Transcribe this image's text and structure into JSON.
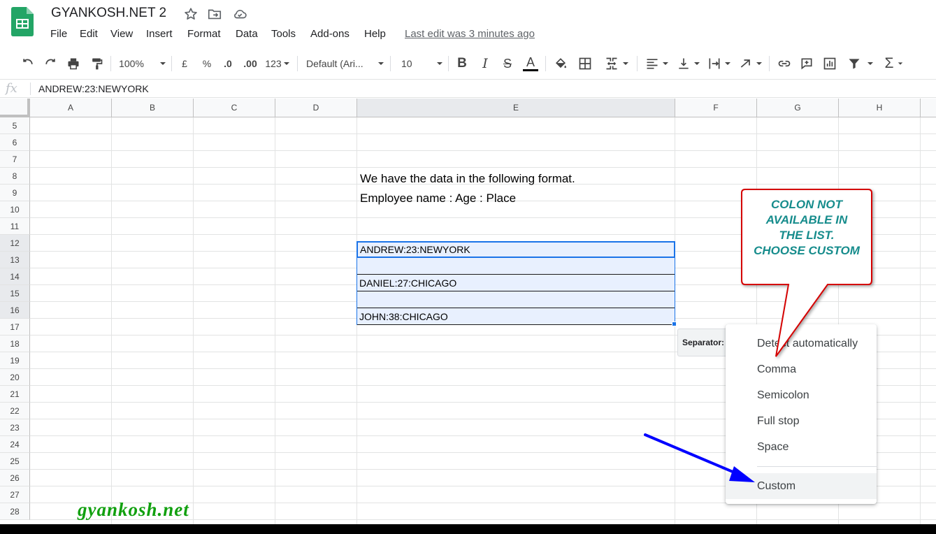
{
  "app": {
    "doc_title": "GYANKOSH.NET 2",
    "last_edit": "Last edit was 3 minutes ago",
    "brand_color": "#188038"
  },
  "menu": [
    "File",
    "Edit",
    "View",
    "Insert",
    "Format",
    "Data",
    "Tools",
    "Add-ons",
    "Help"
  ],
  "toolbar": {
    "zoom": "100%",
    "currency": "£",
    "percent": "%",
    "dec_decrease": ".0",
    "dec_increase": ".00",
    "more_formats": "123",
    "font": "Default (Ari...",
    "font_size": "10",
    "bold": "B",
    "italic": "I",
    "strike": "S",
    "text_color_letter": "A",
    "sigma": "Σ"
  },
  "formula_bar": {
    "fx": "fx",
    "value": "ANDREW:23:NEWYORK"
  },
  "grid": {
    "columns": [
      "A",
      "B",
      "C",
      "D",
      "E",
      "F",
      "G",
      "H"
    ],
    "selected_column": "E",
    "rows": [
      "5",
      "6",
      "7",
      "8",
      "9",
      "10",
      "11",
      "12",
      "13",
      "14",
      "15",
      "16",
      "17",
      "18",
      "19",
      "20",
      "21",
      "22",
      "23",
      "24",
      "25",
      "26",
      "27",
      "28"
    ],
    "selected_rows": [
      "12",
      "13",
      "14",
      "15",
      "16"
    ],
    "notes": {
      "row8": "We have the data in the following format.",
      "row9": "Employee name : Age : Place"
    },
    "data": {
      "e12": "ANDREW:23:NEWYORK",
      "e13": "",
      "e14": "DANIEL:27:CHICAGO",
      "e15": "",
      "e16": "JOHN:38:CHICAGO"
    }
  },
  "separator": {
    "label": "Separator:",
    "options": [
      "Detect automatically",
      "Comma",
      "Semicolon",
      "Full stop",
      "Space",
      "Custom"
    ],
    "highlighted": "Custom"
  },
  "annotation": {
    "callout_lines": [
      "COLON NOT",
      "AVAILABLE IN",
      "THE LIST.",
      "CHOOSE CUSTOM"
    ],
    "callout_text_color": "#168c8c",
    "callout_border_color": "#d50000",
    "arrow_color": "#0000ff",
    "watermark": "gyankosh.net",
    "watermark_color": "#11a00f"
  }
}
